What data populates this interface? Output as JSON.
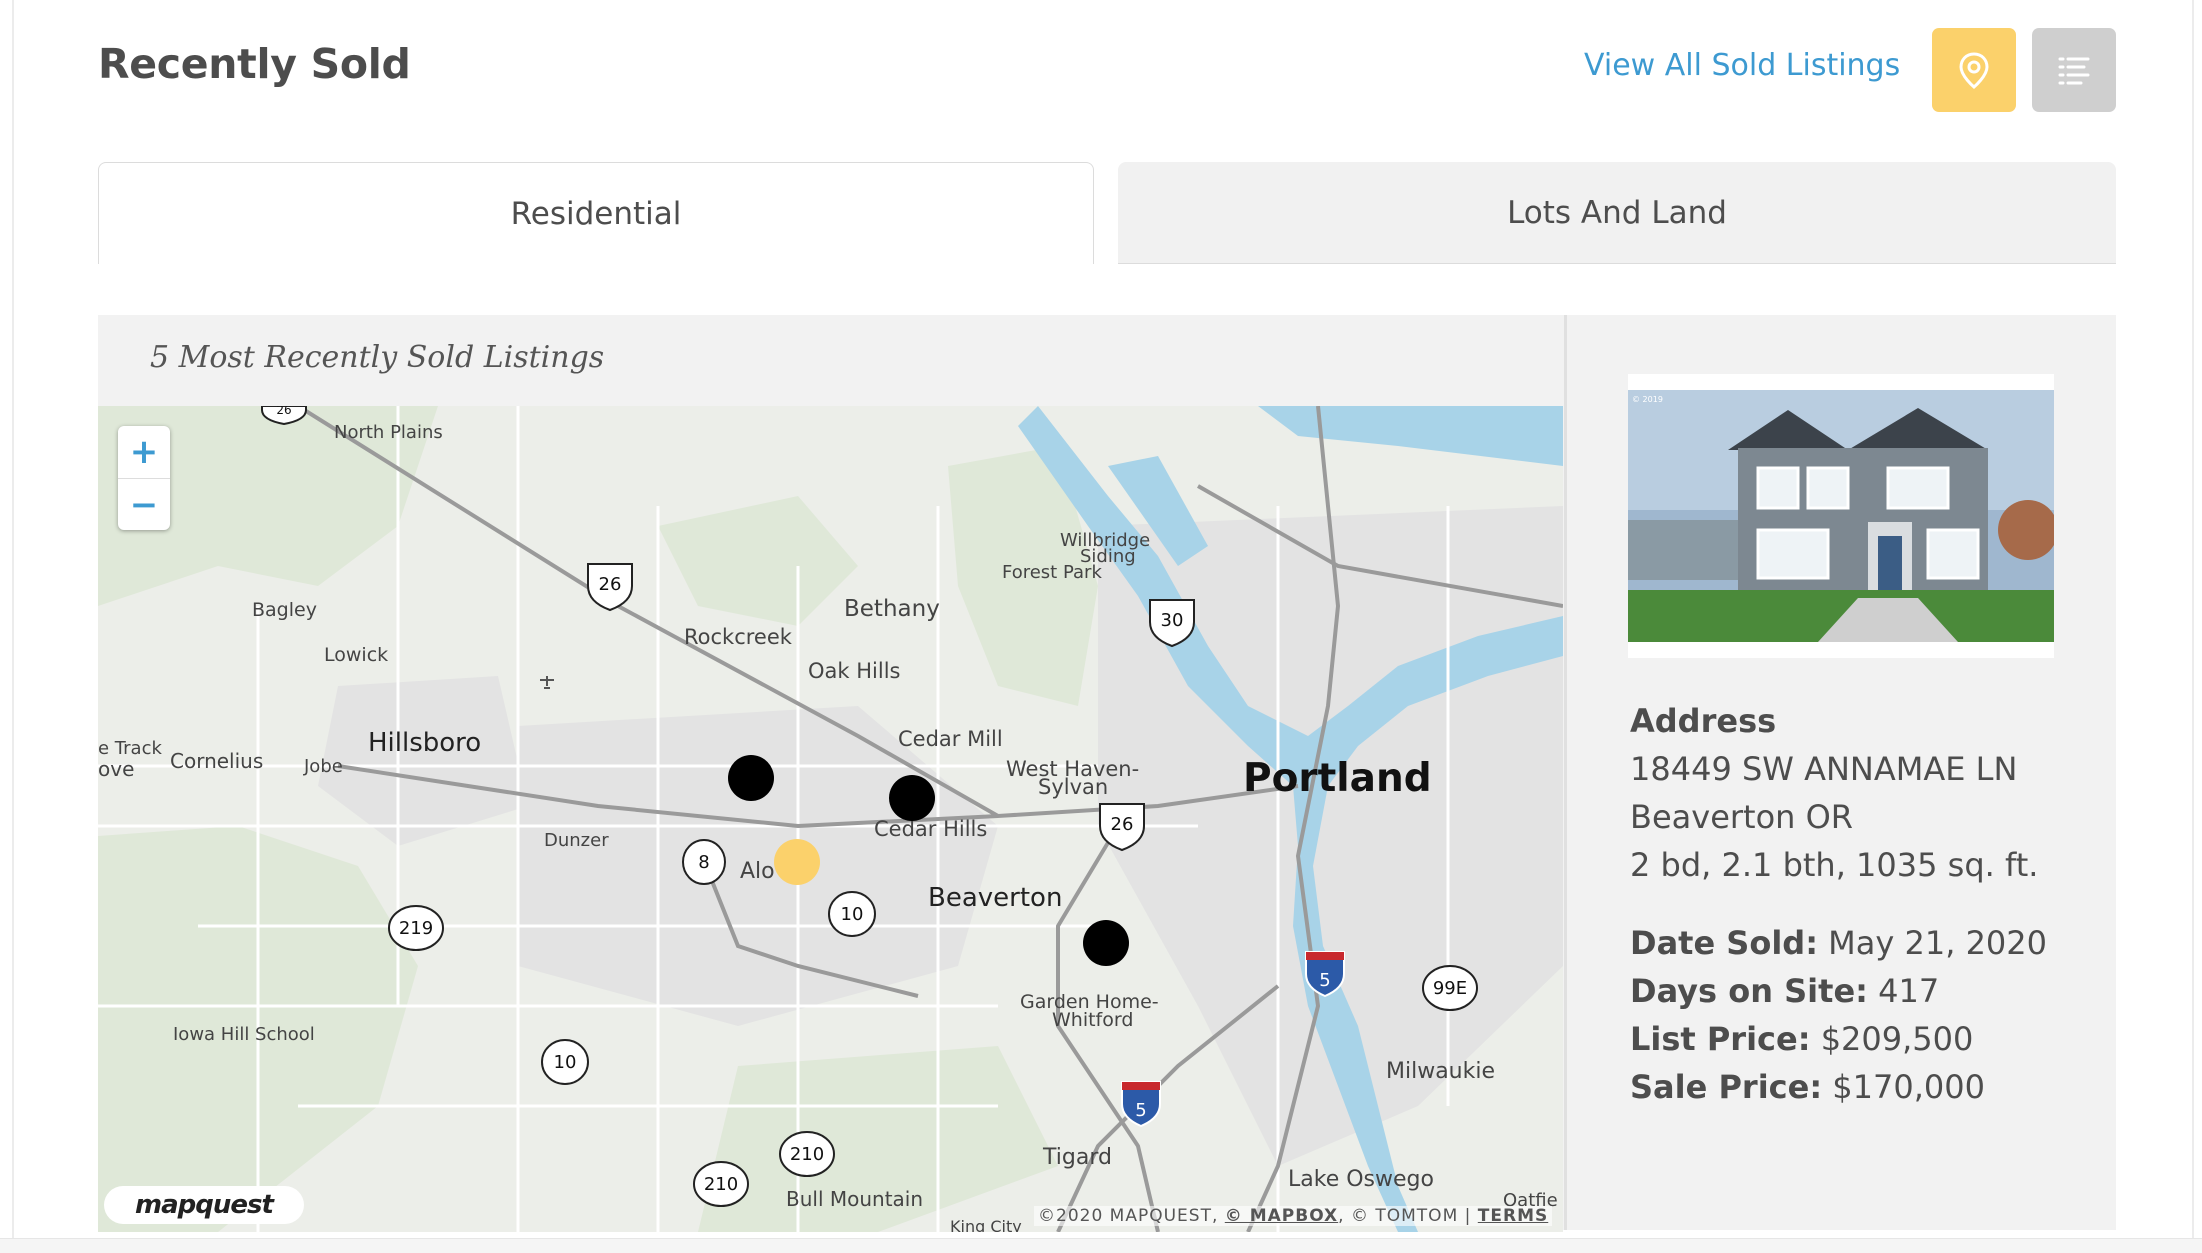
{
  "header": {
    "title": "Recently Sold",
    "view_all_label": "View All Sold Listings"
  },
  "tabs": [
    {
      "label": "Residential",
      "active": true
    },
    {
      "label": "Lots And Land",
      "active": false
    }
  ],
  "panel": {
    "label": "5 Most Recently Sold Listings"
  },
  "map": {
    "zoom_in": "+",
    "zoom_out": "−",
    "logo": "mapquest",
    "attribution": "©2020 MAPQUEST,",
    "attribution_mapbox": "© MAPBOX",
    "attribution_tomtom": ", © TOMTOM |",
    "attribution_terms": "TERMS",
    "places": {
      "portland": "Portland",
      "hillsboro": "Hillsboro",
      "beaverton": "Beaverton",
      "bethany": "Bethany",
      "rockcreek": "Rockcreek",
      "oak_hills": "Oak Hills",
      "cedar_mill": "Cedar Mill",
      "west_haven": "West Haven-",
      "sylvan": "Sylvan",
      "cedar_hills": "Cedar Hills",
      "cornelius": "Cornelius",
      "jobe": "Jobe",
      "track": "e Track",
      "grove": "ove",
      "dunzer": "Dunzer",
      "aloha": "Alo",
      "bagley": "Bagley",
      "lowick": "Lowick",
      "north_plains": "North Plains",
      "willbridge": "Willbridge",
      "siding": "Siding",
      "forest_park": "Forest Park",
      "garden_home": "Garden Home-",
      "whitford": "Whitford",
      "iowa_hill": "Iowa Hill School",
      "tigard": "Tigard",
      "lake_oswego": "Lake Oswego",
      "milwaukie": "Milwaukie",
      "bull_mountain": "Bull Mountain",
      "king_city": "King City",
      "oatfield": "Oatfie"
    },
    "shields": {
      "us26_a": "26",
      "us26_b": "26",
      "us30": "30",
      "or8": "8",
      "or10_a": "10",
      "or10_b": "10",
      "or219": "219",
      "or210_a": "210",
      "or210_b": "210",
      "or99e": "99E",
      "i5_a": "5",
      "i5_b": "5",
      "top_26": "26"
    },
    "colors": {
      "pin": "#000000",
      "pin_selected": "#fbd16b",
      "water": "#a8d3e8",
      "land": "#eceee9"
    }
  },
  "listing": {
    "address_heading": "Address",
    "street": "18449 SW ANNAMAE LN",
    "city": "Beaverton OR",
    "specs": "2 bd, 2.1 bth, 1035 sq. ft.",
    "date_sold_label": "Date Sold:",
    "date_sold": "May 21, 2020",
    "days_label": "Days on Site:",
    "days": "417",
    "list_price_label": "List Price:",
    "list_price": "$209,500",
    "sale_price_label": "Sale Price:",
    "sale_price": "$170,000",
    "photo_caption": "© 2019"
  },
  "colors": {
    "accent": "#3d9ad1",
    "map_button": "#fbd16b",
    "list_button": "#cfcfcf"
  }
}
